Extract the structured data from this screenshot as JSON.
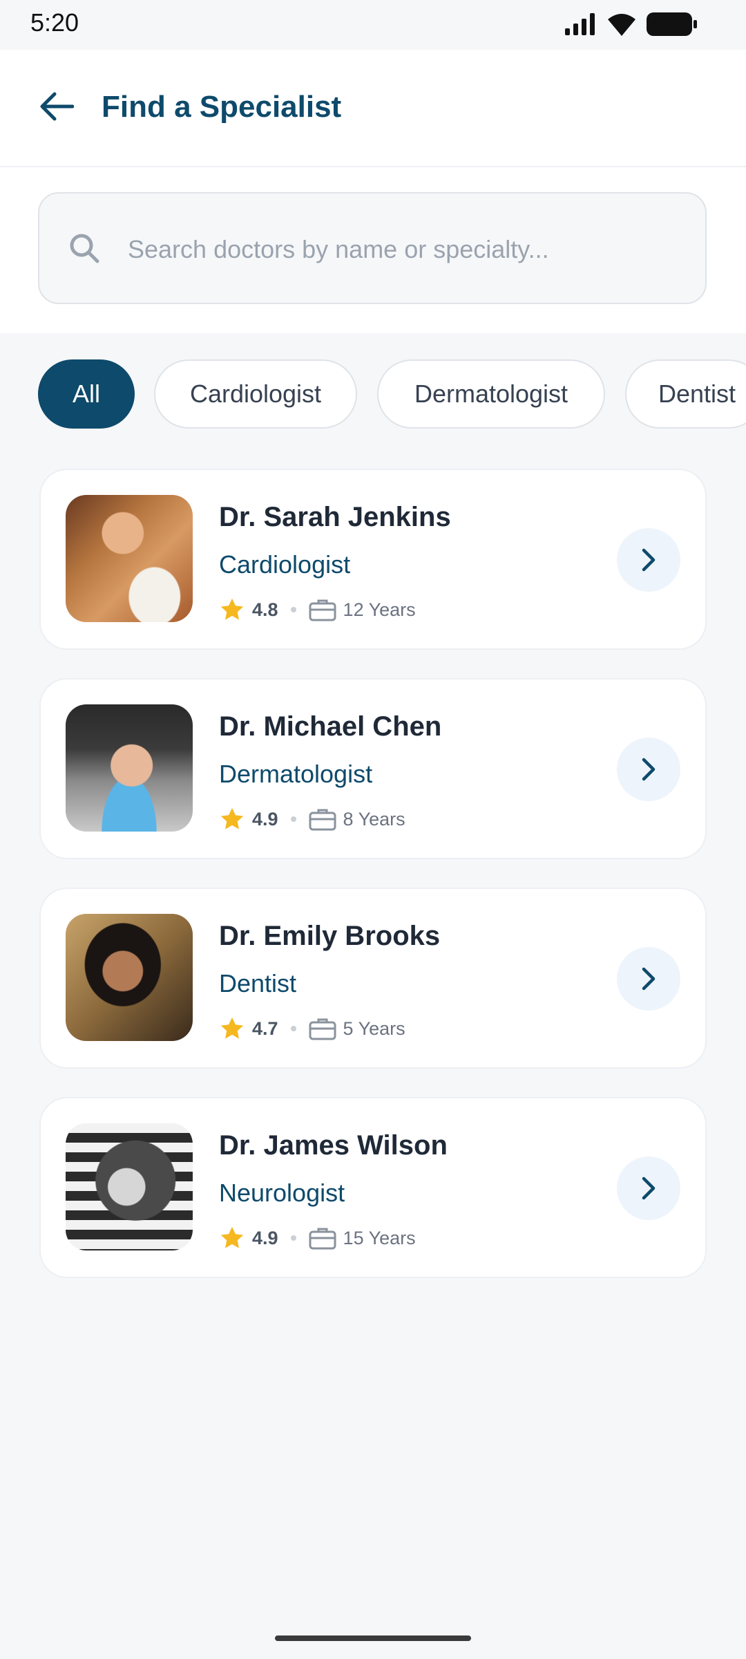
{
  "status_bar": {
    "time": "5:20"
  },
  "header": {
    "title": "Find a Specialist"
  },
  "search": {
    "placeholder": "Search doctors by name or specialty..."
  },
  "filters": [
    {
      "label": "All",
      "active": true
    },
    {
      "label": "Cardiologist",
      "active": false
    },
    {
      "label": "Dermatologist",
      "active": false
    },
    {
      "label": "Dentist",
      "active": false
    }
  ],
  "doctors": [
    {
      "name": "Dr. Sarah Jenkins",
      "specialty": "Cardiologist",
      "rating": "4.8",
      "experience": "12 Years"
    },
    {
      "name": "Dr. Michael Chen",
      "specialty": "Dermatologist",
      "rating": "4.9",
      "experience": "8 Years"
    },
    {
      "name": "Dr. Emily Brooks",
      "specialty": "Dentist",
      "rating": "4.7",
      "experience": "5 Years"
    },
    {
      "name": "Dr. James Wilson",
      "specialty": "Neurologist",
      "rating": "4.9",
      "experience": "15 Years"
    }
  ],
  "colors": {
    "primary": "#0e4a6b",
    "star": "#f5b820",
    "background": "#f6f7f9"
  },
  "icons": [
    "back-arrow-icon",
    "search-icon",
    "star-icon",
    "briefcase-icon",
    "chevron-right-icon",
    "signal-icon",
    "wifi-icon",
    "battery-icon"
  ]
}
